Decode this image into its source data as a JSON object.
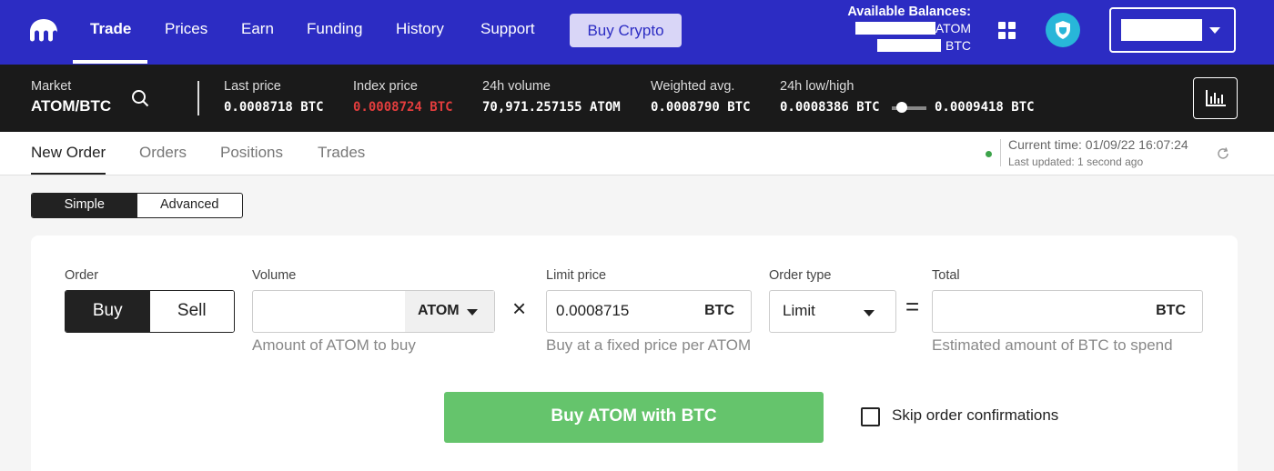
{
  "nav": {
    "items": [
      "Trade",
      "Prices",
      "Earn",
      "Funding",
      "History",
      "Support"
    ],
    "buy_crypto": "Buy Crypto",
    "balances_title": "Available Balances:",
    "balance_atom_unit": "ATOM",
    "balance_btc_unit": "BTC"
  },
  "market": {
    "label": "Market",
    "pair": "ATOM/BTC",
    "stats": [
      {
        "label": "Last price",
        "value": "0.0008718 BTC",
        "highlight": false
      },
      {
        "label": "Index price",
        "value": "0.0008724 BTC",
        "highlight": true
      },
      {
        "label": "24h volume",
        "value": "70,971.257155 ATOM",
        "highlight": false
      },
      {
        "label": "Weighted avg.",
        "value": "0.0008790 BTC",
        "highlight": false
      }
    ],
    "lowhigh_label": "24h low/high",
    "low": "0.0008386 BTC",
    "high": "0.0009418 BTC"
  },
  "tabs": [
    "New Order",
    "Orders",
    "Positions",
    "Trades"
  ],
  "status": {
    "current_time": "Current time: 01/09/22 16:07:24",
    "last_updated": "Last updated: 1 second ago"
  },
  "mode": {
    "simple": "Simple",
    "advanced": "Advanced"
  },
  "order": {
    "order_label": "Order",
    "buy": "Buy",
    "sell": "Sell",
    "volume_label": "Volume",
    "volume_value": "",
    "volume_unit": "ATOM",
    "volume_hint": "Amount of ATOM to buy",
    "times": "×",
    "limit_label": "Limit price",
    "limit_value": "0.0008715",
    "limit_unit": "BTC",
    "limit_hint": "Buy at a fixed price per ATOM",
    "type_label": "Order type",
    "type_value": "Limit",
    "equals": "=",
    "total_label": "Total",
    "total_value": "",
    "total_unit": "BTC",
    "total_hint": "Estimated amount of BTC to spend",
    "submit": "Buy ATOM with BTC",
    "skip_confirm": "Skip order confirmations"
  },
  "colors": {
    "nav_bg": "#2c2cc3",
    "market_bg": "#1a1a1a",
    "submit": "#65c46c",
    "index_price": "#e23d3d"
  }
}
